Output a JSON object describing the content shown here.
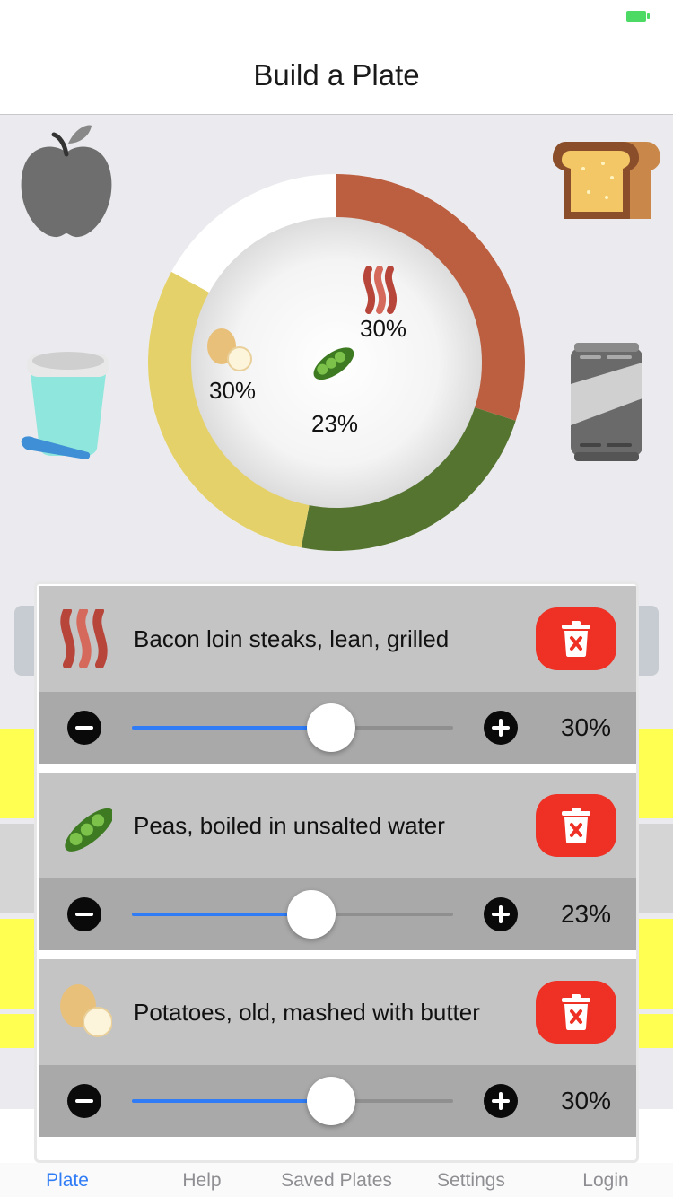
{
  "nav": {
    "title": "Build a Plate"
  },
  "plate": {
    "segments": [
      {
        "name": "Bacon",
        "percent": 30,
        "color": "#bc5e40"
      },
      {
        "name": "Peas",
        "percent": 23,
        "color": "#557430"
      },
      {
        "name": "Potatoes",
        "percent": 30,
        "color": "#e4d16a"
      }
    ],
    "labels": {
      "bacon": "30%",
      "peas": "23%",
      "potatoes": "30%"
    }
  },
  "corner_icons": [
    "apple-icon",
    "toast-icon",
    "yogurt-icon",
    "drink-can-icon"
  ],
  "items": [
    {
      "name": "Bacon loin steaks, lean, grilled",
      "icon": "bacon-icon",
      "value": 0.62,
      "percent_label": "30%"
    },
    {
      "name": "Peas, boiled in unsalted water",
      "icon": "peas-icon",
      "value": 0.56,
      "percent_label": "23%"
    },
    {
      "name": "Potatoes, old, mashed with butter",
      "icon": "potato-icon",
      "value": 0.62,
      "percent_label": "30%"
    }
  ],
  "tabs": [
    {
      "label": "Plate",
      "active": true
    },
    {
      "label": "Help"
    },
    {
      "label": "Saved Plates"
    },
    {
      "label": "Settings"
    },
    {
      "label": "Login"
    }
  ],
  "colors": {
    "accent": "#2f7cf6",
    "delete": "#ee3124",
    "background": "#ebebef"
  }
}
